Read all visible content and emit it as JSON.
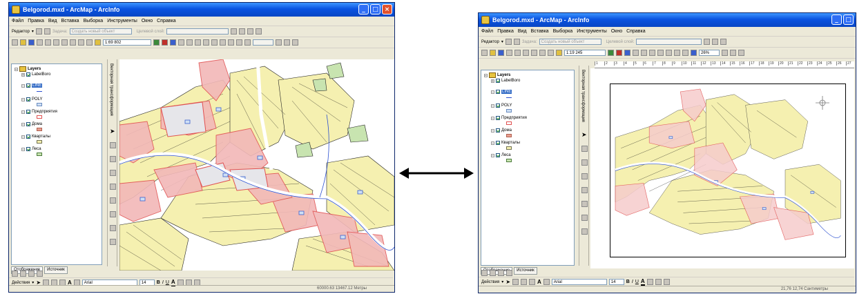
{
  "left_window": {
    "title": "Belgorod.mxd - ArcMap - ArcInfo",
    "menu": [
      "Файл",
      "Правка",
      "Вид",
      "Вставка",
      "Выборка",
      "Инструменты",
      "Окно",
      "Справка"
    ],
    "editor_label": "Редактор",
    "task_label": "Задача:",
    "task_value": "Создать новый объект",
    "target_label": "Целевой слой:",
    "scale": "1:69 802",
    "toc_root": "Layers",
    "layers": [
      "LabelBoro",
      "LINE",
      "POLY",
      "Предприятия",
      "Дома",
      "Кварталы",
      "Леса"
    ],
    "tabs": [
      "Отображение",
      "Источник"
    ],
    "vertical_toolbar": "Векторная трансформация",
    "draw_label": "Действия",
    "font_name": "Arial",
    "font_size": "14",
    "status_text": "60000.63  13467.12 Метры"
  },
  "right_window": {
    "title": "Belgorod.mxd - ArcMap - ArcInfo",
    "menu": [
      "Файл",
      "Правка",
      "Вид",
      "Вставка",
      "Выборка",
      "Инструменты",
      "Окно",
      "Справка"
    ],
    "editor_label": "Редактор",
    "task_label": "Задача:",
    "task_value": "Создать новый объект",
    "target_label": "Целевой слой:",
    "scale": "1:19 245",
    "zoom": "26%",
    "toc_root": "Layers",
    "layers": [
      "LabelBoro",
      "LINE",
      "POLY",
      "Предприятия",
      "Дома",
      "Кварталы",
      "Леса"
    ],
    "tabs": [
      "Отображение",
      "Источник"
    ],
    "vertical_toolbar": "Векторная трансформация",
    "draw_label": "Действия",
    "font_name": "Arial",
    "font_size": "14",
    "status_text": "21,76  12,74 Сантиметры",
    "ruler_marks": [
      "1",
      "2",
      "3",
      "4",
      "5",
      "6",
      "7",
      "8",
      "9",
      "10",
      "11",
      "12",
      "13",
      "14",
      "15",
      "16",
      "17",
      "18",
      "19",
      "20",
      "21",
      "22",
      "23",
      "24",
      "25",
      "26",
      "27",
      "28",
      "29",
      "30",
      "31"
    ]
  },
  "colors": {
    "title_blue": "#0a53e0",
    "arrow": "#000000",
    "enterprise_red": "#e05050",
    "houses_pink": "#f2b8b8",
    "blocks_yellow": "#f5f0b0",
    "forest_green": "#c8e4b0",
    "line_blue": "#2a4fd0"
  }
}
